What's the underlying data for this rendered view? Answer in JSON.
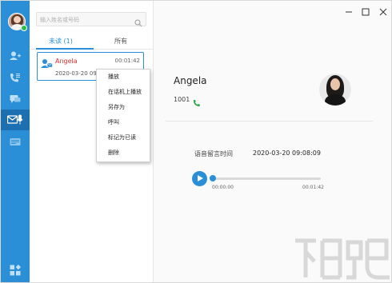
{
  "search": {
    "placeholder": "输入姓名或号码"
  },
  "tabs": [
    {
      "label": "未读 (1)"
    },
    {
      "label": "所有"
    }
  ],
  "voicemail_item": {
    "name": "Angela",
    "duration": "00:01:42",
    "date": "2020-03-20 09:08"
  },
  "context_menu": [
    {
      "label": "播放"
    },
    {
      "label": "在话机上播放"
    },
    {
      "label": "另存为"
    },
    {
      "label": "呼叫"
    },
    {
      "label": "标记为已读"
    },
    {
      "label": "删除"
    }
  ],
  "contact": {
    "name": "Angela",
    "extension": "1001"
  },
  "voicemail_time": {
    "label": "语音留言时间",
    "value": "2020-03-20 09:08:09"
  },
  "player": {
    "current_time": "00:00:00",
    "total_time": "00:01:42",
    "progress": 0
  },
  "colors": {
    "accent": "#2a8fd6",
    "unread_name": "#e0302a",
    "status_online": "#27c046"
  },
  "icons": [
    "add-contact-icon",
    "call-log-icon",
    "chat-icon",
    "voicemail-icon",
    "conference-icon",
    "apps-icon"
  ]
}
